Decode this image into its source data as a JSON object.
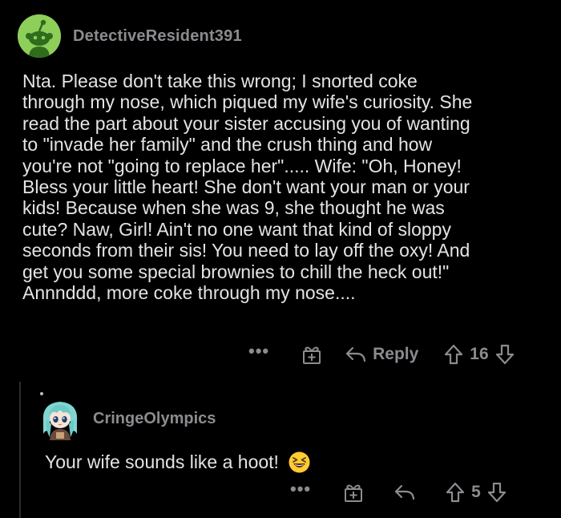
{
  "comment": {
    "username": "DetectiveResident391",
    "avatar_icon": "snoo-avatar-icon",
    "lines": [
      "Nta. Please don't take this wrong; I snorted coke",
      "through my nose, which piqued my wife's curiosity. She",
      "read the part about your sister accusing you of wanting",
      "to \"invade her family\" and the crush thing and how",
      "you're not \"going to replace her\"..... Wife: \"Oh, Honey!",
      "Bless your little heart! She don't want your man or your",
      "kids! Because when she was 9, she thought he was",
      "cute? Naw, Girl! Ain't no one want that kind of sloppy",
      "seconds from their sis! You need to lay off the oxy! And",
      "get you some special brownies to chill the heck out!\"",
      "Annnddd, more coke through my nose...."
    ],
    "actions": {
      "more_label": "•••",
      "reply_label": "Reply",
      "vote_count": "16"
    }
  },
  "reply": {
    "username": "CringeOlympics",
    "avatar_icon": "anime-girl-avatar-icon",
    "body": "Your wife sounds like a hoot!",
    "emoji": "laughing-face-emoji",
    "actions": {
      "more_label": "•••",
      "vote_count": "5"
    }
  },
  "colors": {
    "background": "#000000",
    "text": "#e2e4e6",
    "muted": "#8a8c8f",
    "snoo_green": "#8ecf5a"
  }
}
